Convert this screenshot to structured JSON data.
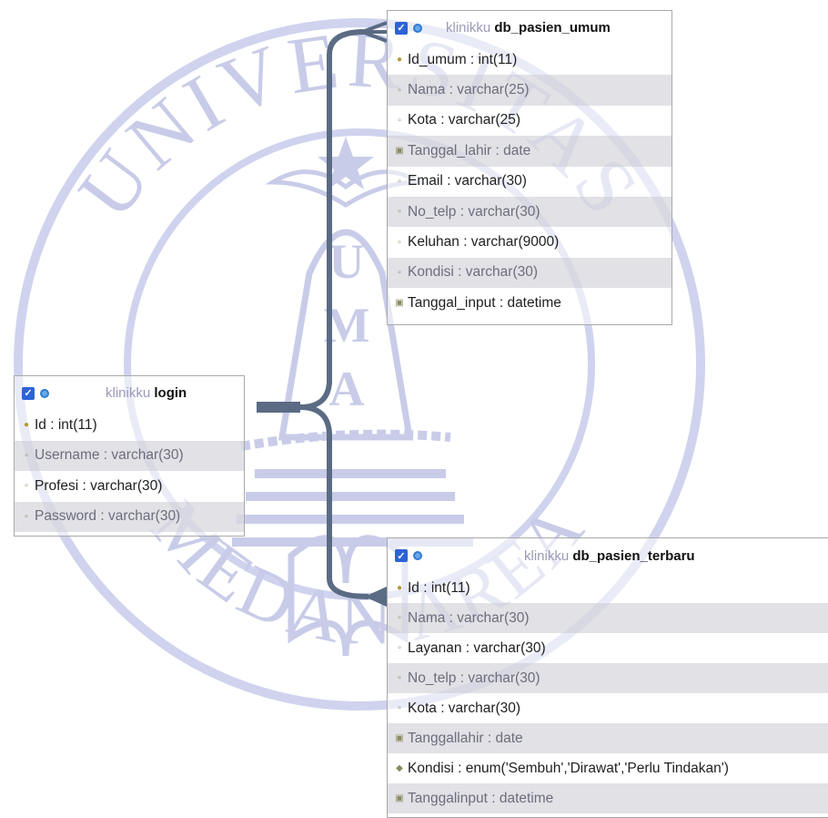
{
  "tables": {
    "umum": {
      "db": "klinikku",
      "name": "db_pasien_umum",
      "rows": [
        {
          "label": "Id_umum : int(11)",
          "icon": "key-icon"
        },
        {
          "label": "Nama : varchar(25)",
          "icon": "column-icon"
        },
        {
          "label": "Kota : varchar(25)",
          "icon": "column-icon"
        },
        {
          "label": "Tanggal_lahir : date",
          "icon": "date-icon"
        },
        {
          "label": "Email : varchar(30)",
          "icon": "column-icon"
        },
        {
          "label": "No_telp : varchar(30)",
          "icon": "column-icon"
        },
        {
          "label": "Keluhan : varchar(9000)",
          "icon": "column-icon"
        },
        {
          "label": "Kondisi : varchar(30)",
          "icon": "column-icon"
        },
        {
          "label": "Tanggal_input : datetime",
          "icon": "date-icon"
        }
      ]
    },
    "login": {
      "db": "klinikku",
      "name": "login",
      "rows": [
        {
          "label": "Id : int(11)",
          "icon": "key-icon"
        },
        {
          "label": "Username : varchar(30)",
          "icon": "column-icon"
        },
        {
          "label": "Profesi : varchar(30)",
          "icon": "column-icon"
        },
        {
          "label": "Password : varchar(30)",
          "icon": "column-icon"
        }
      ]
    },
    "terbaru": {
      "db": "klinikku",
      "name": "db_pasien_terbaru",
      "rows": [
        {
          "label": "Id : int(11)",
          "icon": "key-icon"
        },
        {
          "label": "Nama : varchar(30)",
          "icon": "column-icon"
        },
        {
          "label": "Layanan : varchar(30)",
          "icon": "column-icon"
        },
        {
          "label": "No_telp : varchar(30)",
          "icon": "column-icon"
        },
        {
          "label": "Kota : varchar(30)",
          "icon": "column-icon"
        },
        {
          "label": "Tanggallahir : date",
          "icon": "date-icon"
        },
        {
          "label": "Kondisi : enum('Sembuh','Dirawat','Perlu Tindakan')",
          "icon": "enum-icon"
        },
        {
          "label": "Tanggalinput : datetime",
          "icon": "date-icon"
        }
      ]
    }
  },
  "watermark": {
    "top_text": "UNIVERSITAS",
    "bottom_text": "MEDAN AREA",
    "logo_text": "UMA"
  },
  "colors": {
    "connector": "#5b6b84",
    "watermark": "#c8cce8",
    "checkbox": "#2d63d8"
  }
}
